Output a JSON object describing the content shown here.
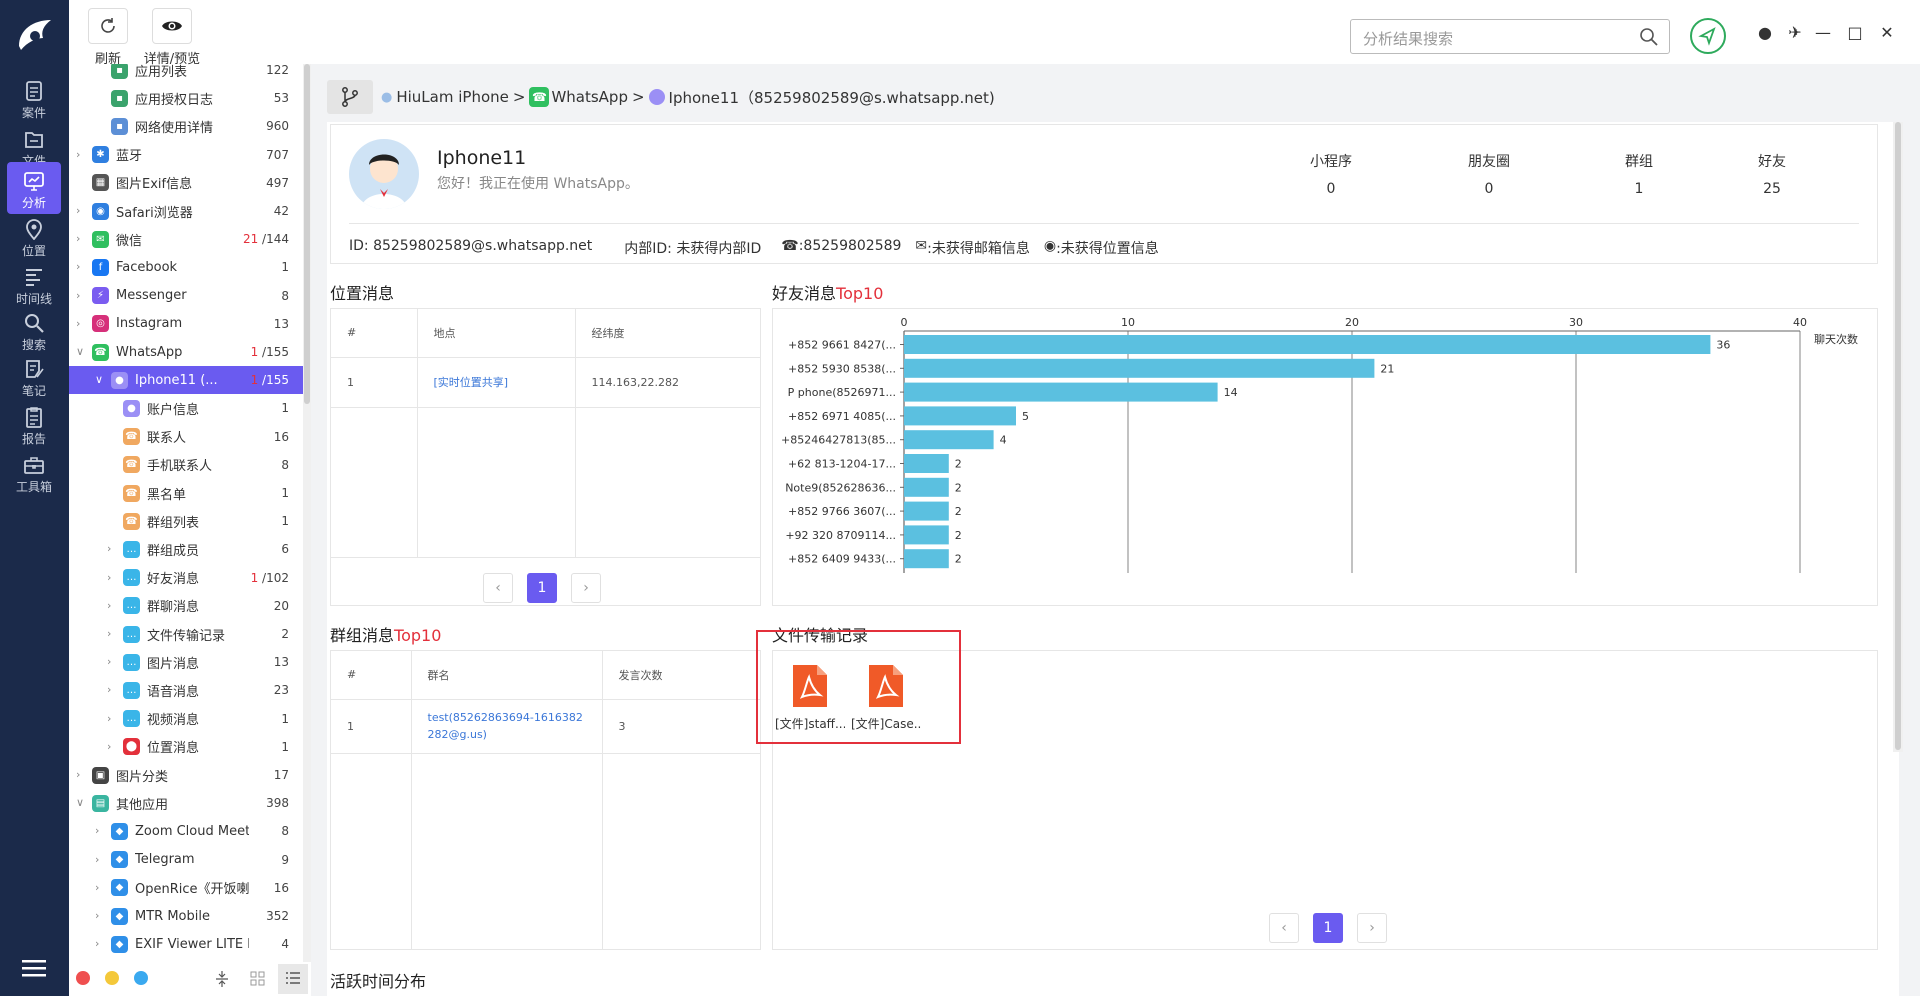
{
  "nav": {
    "items": [
      {
        "label": "案件",
        "icon": "case-icon"
      },
      {
        "label": "文件",
        "icon": "file-icon"
      },
      {
        "label": "分析",
        "icon": "analysis-icon"
      },
      {
        "label": "位置",
        "icon": "location-icon"
      },
      {
        "label": "时间线",
        "icon": "timeline-icon"
      },
      {
        "label": "搜索",
        "icon": "search-icon"
      },
      {
        "label": "笔记",
        "icon": "note-icon"
      },
      {
        "label": "报告",
        "icon": "report-icon"
      },
      {
        "label": "工具箱",
        "icon": "toolbox-icon"
      }
    ],
    "active": "分析"
  },
  "toolbar": {
    "refresh_label": "刷新",
    "preview_label": "详情/预览"
  },
  "search": {
    "placeholder": "分析结果搜索"
  },
  "tree": [
    {
      "label": "应用列表",
      "count": "122"
    },
    {
      "label": "应用授权日志",
      "count": "53"
    },
    {
      "label": "网络使用详情",
      "count": "960"
    },
    {
      "label": "蓝牙",
      "count": "707"
    },
    {
      "label": "图片Exif信息",
      "count": "497"
    },
    {
      "label": "Safari浏览器",
      "count": "42"
    },
    {
      "label": "微信",
      "count_red": "21",
      "count": "/144"
    },
    {
      "label": "Facebook",
      "count": "1"
    },
    {
      "label": "Messenger",
      "count": "8"
    },
    {
      "label": "Instagram",
      "count": "13"
    },
    {
      "label": "WhatsApp",
      "count_red": "1",
      "count": "/155"
    },
    {
      "label": "Iphone11 (...",
      "count_red": "1",
      "count": "/155"
    },
    {
      "label": "账户信息",
      "count": "1"
    },
    {
      "label": "联系人",
      "count": "16"
    },
    {
      "label": "手机联系人",
      "count": "8"
    },
    {
      "label": "黑名单",
      "count": "1"
    },
    {
      "label": "群组列表",
      "count": "1"
    },
    {
      "label": "群组成员",
      "count": "6"
    },
    {
      "label": "好友消息",
      "count_red": "1",
      "count": "/102"
    },
    {
      "label": "群聊消息",
      "count": "20"
    },
    {
      "label": "文件传输记录",
      "count": "2"
    },
    {
      "label": "图片消息",
      "count": "13"
    },
    {
      "label": "语音消息",
      "count": "23"
    },
    {
      "label": "视频消息",
      "count": "1"
    },
    {
      "label": "位置消息",
      "count": "1"
    },
    {
      "label": "图片分类",
      "count": "17"
    },
    {
      "label": "其他应用",
      "count": "398"
    },
    {
      "label": "Zoom Cloud Meeti...",
      "count": "8"
    },
    {
      "label": "Telegram",
      "count": "9"
    },
    {
      "label": "OpenRice《开饭喇...",
      "count": "16"
    },
    {
      "label": "MTR Mobile",
      "count": "352"
    },
    {
      "label": "EXIF Viewer LITE b...",
      "count": "4"
    }
  ],
  "breadcrumb": {
    "device": "HiuLam iPhone",
    "app": "WhatsApp",
    "account": "Iphone11（85259802589@s.whatsapp.net)",
    "sep": ">"
  },
  "profile": {
    "name": "Iphone11",
    "status": "您好！我正在使用 WhatsApp。",
    "stats": [
      {
        "label": "小程序",
        "value": "0"
      },
      {
        "label": "朋友圈",
        "value": "0"
      },
      {
        "label": "群组",
        "value": "1"
      },
      {
        "label": "好友",
        "value": "25"
      }
    ],
    "id": "ID: 85259802589@s.whatsapp.net",
    "internal_id": "内部ID: 未获得内部ID",
    "phone": ":85259802589",
    "email": ":未获得邮箱信息",
    "location": ":未获得位置信息"
  },
  "location_msg": {
    "title": "位置消息",
    "headers": [
      "#",
      "地点",
      "经纬度"
    ],
    "rows": [
      {
        "no": "1",
        "place": "[实时位置共享]",
        "coord": "114.163,22.282"
      }
    ],
    "page": "1"
  },
  "group_msg": {
    "title": "群组消息",
    "title_red": "Top10",
    "headers": [
      "#",
      "群名",
      "发言次数"
    ],
    "rows": [
      {
        "no": "1",
        "name": "test(85262863694-1616382282@g.us)",
        "count": "3"
      }
    ]
  },
  "friend_msg": {
    "title": "好友消息",
    "title_red": "Top10"
  },
  "file_transfer": {
    "title": "文件传输记录",
    "files": [
      "[文件]staff...",
      "[文件]Case..."
    ],
    "page": "1"
  },
  "activity": {
    "title": "活跃时间分布"
  },
  "chart_data": {
    "type": "bar",
    "orientation": "horizontal",
    "categories": [
      "+852 9661 8427(...",
      "+852 5930 8538(...",
      "P phone(8526971...",
      "+852 6971 4085(...",
      "+85246427813(85...",
      "+62 813-1204-17...",
      "Note9(852628636...",
      "+852 9766 3607(...",
      "+92 320 8709114...",
      "+852 6409 9433(..."
    ],
    "values": [
      36,
      21,
      14,
      5,
      4,
      2,
      2,
      2,
      2,
      2
    ],
    "xlim": [
      0,
      40
    ],
    "ticks": [
      0,
      10,
      20,
      30,
      40
    ],
    "xlabel": "聊天次数",
    "grid": true,
    "color": "#5bc0e0"
  },
  "colors": {
    "accent": "#6a5bf0",
    "nav_bg": "#1b2a4a",
    "red": "#e3303b",
    "link": "#3b77d8",
    "pdf": "#f05a28",
    "highlight_box": "#e3303b"
  }
}
